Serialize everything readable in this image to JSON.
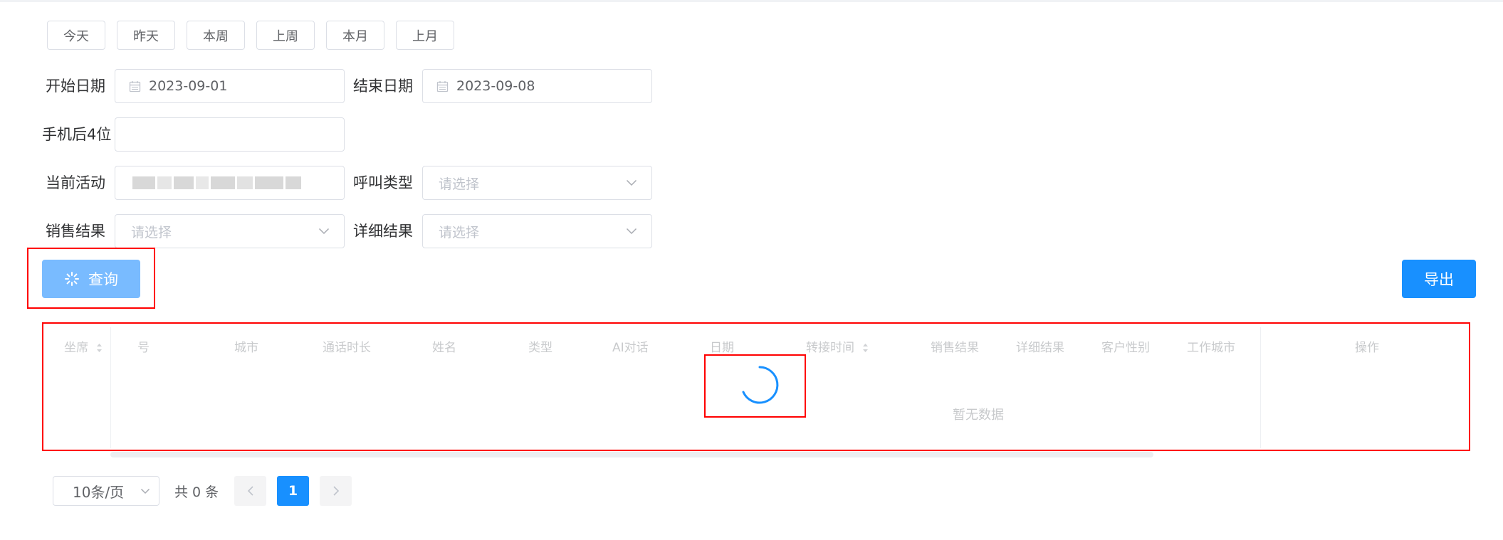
{
  "quick_filters": [
    "今天",
    "昨天",
    "本周",
    "上周",
    "本月",
    "上月"
  ],
  "form": {
    "start_date_label": "开始日期",
    "start_date_value": "2023-09-01",
    "end_date_label": "结束日期",
    "end_date_value": "2023-09-08",
    "phone_label": "手机后4位",
    "phone_value": "",
    "activity_label": "当前活动",
    "call_type_label": "呼叫类型",
    "call_type_placeholder": "请选择",
    "sales_result_label": "销售结果",
    "sales_result_placeholder": "请选择",
    "detail_result_label": "详细结果",
    "detail_result_placeholder": "请选择"
  },
  "buttons": {
    "query": "查询",
    "export": "导出"
  },
  "table": {
    "columns": [
      "坐席",
      "号",
      "城市",
      "通话时长",
      "姓名",
      "类型",
      "AI对话",
      "日期",
      "转接时间",
      "销售结果",
      "详细结果",
      "客户性别",
      "工作城市",
      "操作"
    ],
    "empty_text": "暂无数据"
  },
  "pagination": {
    "page_size": "10条/页",
    "total": "共 0 条",
    "current_page": "1"
  },
  "colors": {
    "primary": "#1890ff",
    "primary_loading": "#79bbff",
    "highlight": "#ff0000"
  }
}
